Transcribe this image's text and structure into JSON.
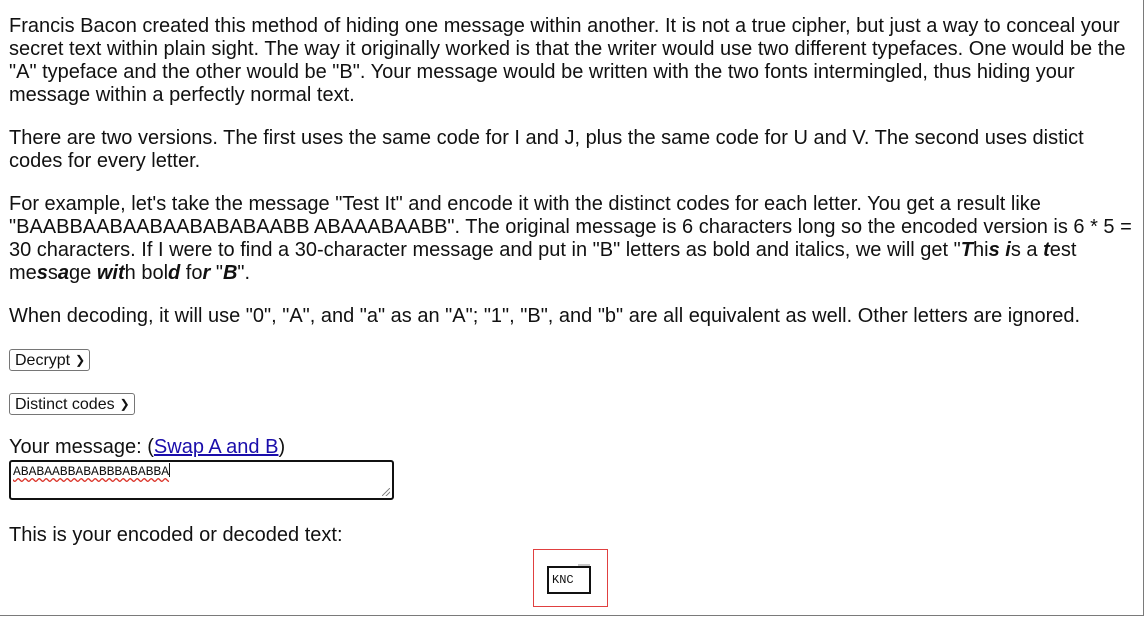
{
  "intro": {
    "para1": "Francis Bacon created this method of hiding one message within another. It is not a true cipher, but just a way to conceal your secret text within plain sight. The way it originally worked is that the writer would use two different typefaces. One would be the \"A\" typeface and the other would be \"B\". Your message would be written with the two fonts intermingled, thus hiding your message within a perfectly normal text.",
    "para2": "There are two versions. The first uses the same code for I and J, plus the same code for U and V. The second uses distict codes for every letter.",
    "para3_start": "For example, let's take the message \"Test It\" and encode it with the distinct codes for each letter. You get a result like \"BAABBAABAABAABABABAABB ABAAABAABB\". The original message is 6 characters long so the encoded version is 6 * 5 = 30 characters. If I were to find a 30-character message and put in \"B\" letters as bold and italics, we will get \"",
    "para3_end": "\".",
    "para4": "When decoding, it will use \"0\", \"A\", and \"a\" as an \"A\"; \"1\", \"B\", and \"b\" are all equivalent as well. Other letters are ignored."
  },
  "mode_select": {
    "selected": "Decrypt",
    "icon": "chevron-down-icon"
  },
  "alphabet_select": {
    "selected": "Distinct codes",
    "icon": "chevron-down-icon"
  },
  "message": {
    "label_prefix": "Your message: (",
    "swap_link": "Swap A and B",
    "label_suffix": ")",
    "value": "ABABAABBABABBBABABBA"
  },
  "output": {
    "label": "This is your encoded or decoded text:",
    "captcha_text": "KNC"
  },
  "colors": {
    "link": "#1a0dab",
    "spellcheck_underline": "#d93025",
    "captcha_border": "#e04040"
  }
}
